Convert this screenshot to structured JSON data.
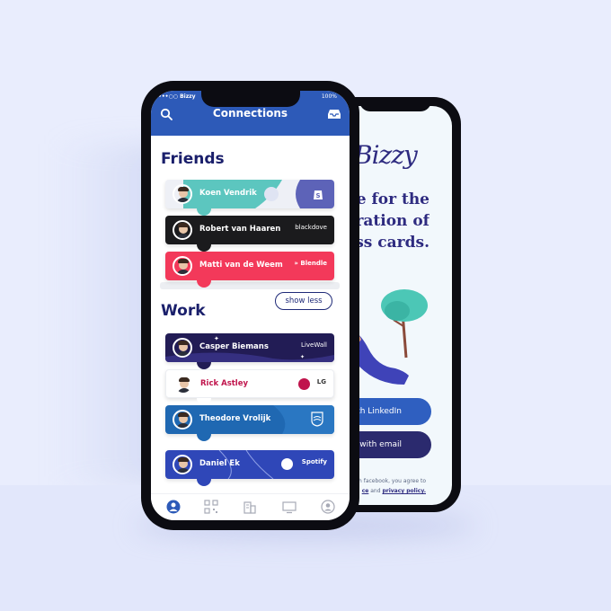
{
  "colors": {
    "background": "#e9edfd",
    "header": "#2d5ab8",
    "title": "#1a1f6b",
    "back_heading": "#2e2b80"
  },
  "back_screen": {
    "logo": "Bizzy",
    "tagline": [
      "e for the",
      "eration of",
      "ss cards."
    ],
    "linkedin_label": "ith LinkedIn",
    "email_label": "r with email",
    "legal_line1": "th facebook, you agree to",
    "legal_terms": "ce",
    "legal_and": " and ",
    "legal_privacy": "privacy policy."
  },
  "front_screen": {
    "status": {
      "carrier": "•••○○ Bizzy",
      "battery": "100%"
    },
    "header": {
      "title": "Connections",
      "left_icon": "search-icon",
      "right_icon": "inbox-icon"
    },
    "friends_title": "Friends",
    "work_title": "Work",
    "show_less_label": "show less",
    "friends": [
      {
        "name": "Koen Vendrik",
        "brand": "shopify-icon",
        "color": "#5cc6bf"
      },
      {
        "name": "Robert van Haaren",
        "brand": "blackdove",
        "color": "#1b1b1d"
      },
      {
        "name": "Matti van de Weem",
        "brand": "» Blendle",
        "color": "#f3395a"
      }
    ],
    "work": [
      {
        "name": "Casper Biemans",
        "brand": "LiveWall",
        "color": "#221c55"
      },
      {
        "name": "Rick Astley",
        "brand": "LG",
        "color": "#ffffff"
      },
      {
        "name": "Theodore Vrolijk",
        "brand": "philips-icon",
        "color": "#1f68b2"
      },
      {
        "name": "Daniel Ek",
        "brand": "Spotify",
        "color": "#2f47b8"
      }
    ],
    "tabs": [
      "profile-icon",
      "qr-code-icon",
      "building-icon",
      "tv-icon",
      "account-icon"
    ]
  }
}
